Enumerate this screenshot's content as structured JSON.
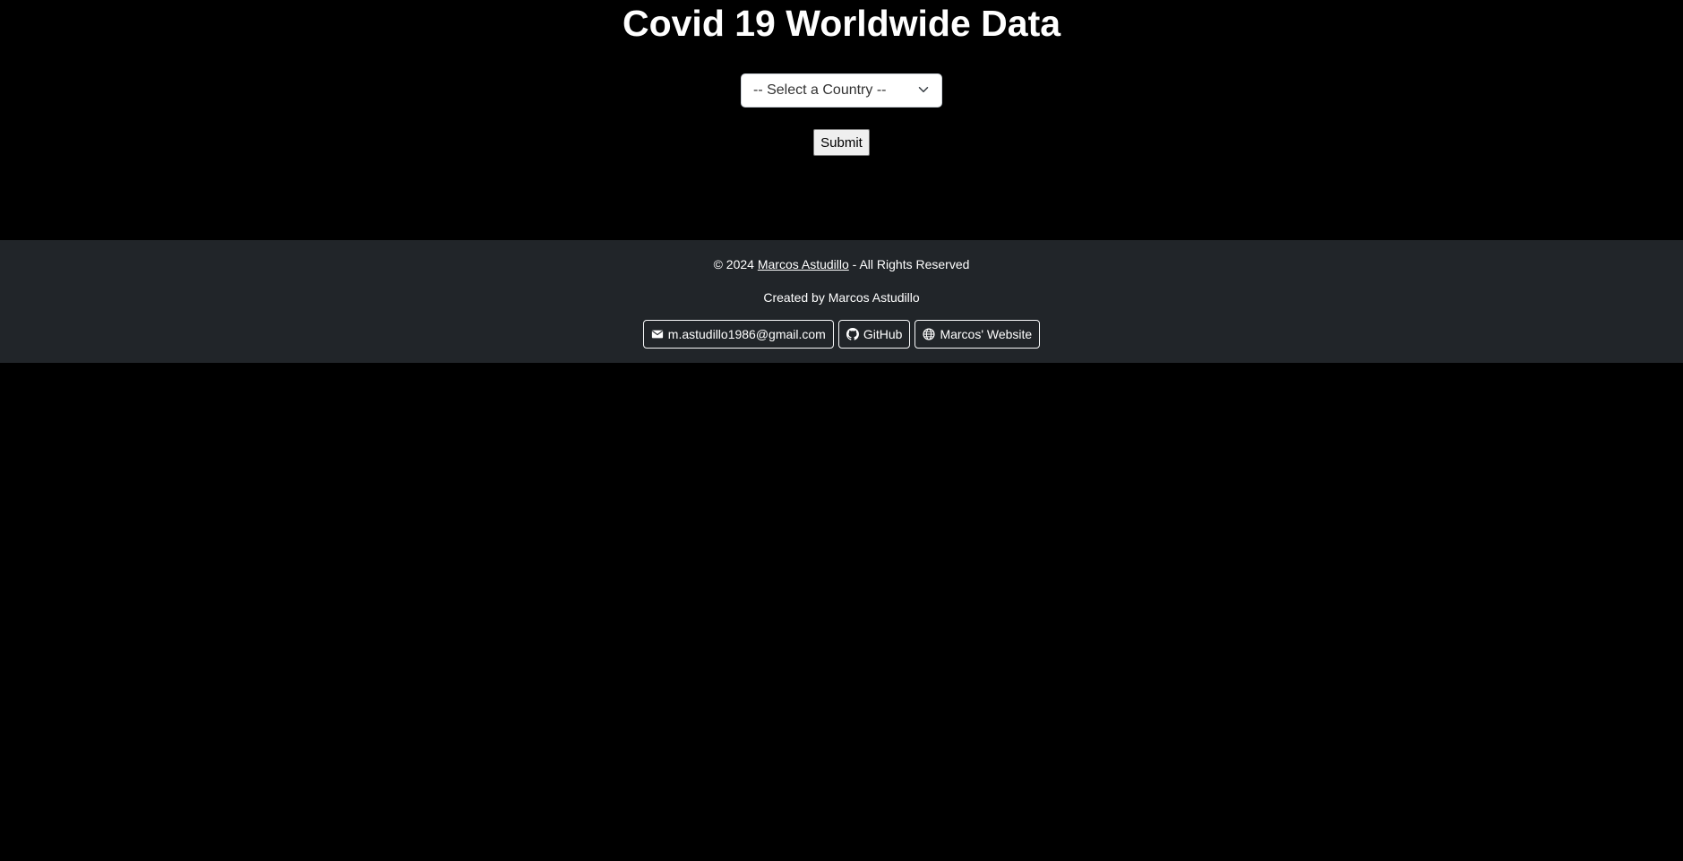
{
  "header": {
    "title": "Covid 19 Worldwide Data"
  },
  "form": {
    "country_select_value": "-- Select a Country --",
    "submit_label": "Submit"
  },
  "footer": {
    "copyright_prefix": "© 2024 ",
    "author_link": "Marcos Astudillo",
    "copyright_suffix": " - All Rights Reserved",
    "created_by": "Created by Marcos Astudillo",
    "links": [
      {
        "label": "m.astudillo1986@gmail.com",
        "icon": "envelope-icon"
      },
      {
        "label": "GitHub",
        "icon": "github-icon"
      },
      {
        "label": "Marcos' Website",
        "icon": "globe-icon"
      }
    ]
  },
  "colors": {
    "background": "#000000",
    "footer_background": "#212529",
    "text": "#ffffff"
  }
}
